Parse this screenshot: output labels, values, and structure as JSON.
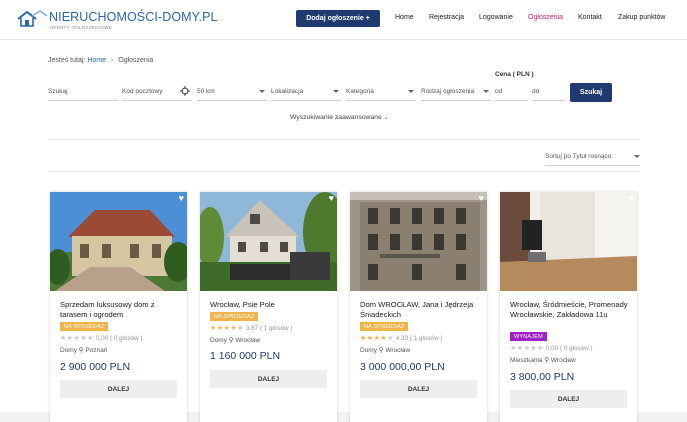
{
  "header": {
    "logo_title": "NIERUCHOMOŚCI-DOMY.PL",
    "logo_subtitle": "OFERTY OGŁOSZENIOWE",
    "add_button": "Dodaj ogłoszenie +",
    "nav": [
      "Home",
      "Rejestracja",
      "Logowanie",
      "Ogłoszenia",
      "Kontakt",
      "Zakup punktów"
    ],
    "active_nav": "Ogłoszenia",
    "brand_color": "#2a66a8",
    "active_color": "#c0257a"
  },
  "breadcrumb": {
    "prefix": "Jesteś tutaj:",
    "home": "Home",
    "current": "Ogłoszenia"
  },
  "search": {
    "query_placeholder": "Szukaj",
    "postal_placeholder": "Kod pocztowy",
    "radius": "50 km",
    "location": "Lokalizacja",
    "category": "Kategoria",
    "ad_type": "Rodzaj ogłoszenia",
    "price_label": "Cena ( PLN )",
    "price_from": "od",
    "price_to": "do",
    "submit": "Szukaj",
    "advanced": "Wyszukiwanie zaawansowane"
  },
  "sort": {
    "selected": "Sortuj po Tytuł rosnąco"
  },
  "listings": [
    {
      "title": "Sprzedam luksusowy dom z tarasem i ogrodem",
      "badge": "NA SPRZEDAŻ",
      "badge_type": "sale",
      "stars_filled": 0,
      "rating": "0,00 ( 0 głosów )",
      "type": "Domy",
      "city": "Poznań",
      "price": "2 900 000 PLN",
      "button": "DALEJ"
    },
    {
      "title": "Wrocław, Psie Pole",
      "badge": "NA SPRZEDAŻ",
      "badge_type": "sale",
      "stars_filled": 4,
      "rating": "3.67 ( 1 głosów )",
      "type": "Domy",
      "city": "Wrocław",
      "price": "1 160 000 PLN",
      "button": "DALEJ"
    },
    {
      "title": "Dom WROCŁAW, Jana i Jędrzeja Śniadeckich",
      "badge": "NA SPRZEDAŻ",
      "badge_type": "sale",
      "stars_filled": 4,
      "rating": "4.33 ( 1 głosów )",
      "type": "Domy",
      "city": "Wrocław",
      "price": "3 000 000,00 PLN",
      "button": "DALEJ"
    },
    {
      "title": "Wrocław, Śródmieście, Promenady Wrocławskie, Zakładowa 11u",
      "badge": "WYNAJEM",
      "badge_type": "rent",
      "stars_filled": 0,
      "rating": "0,00 ( 0 głosów )",
      "type": "Mieszkania",
      "city": "Wrocław",
      "price": "3 800,00 PLN",
      "button": "DALEJ"
    }
  ]
}
